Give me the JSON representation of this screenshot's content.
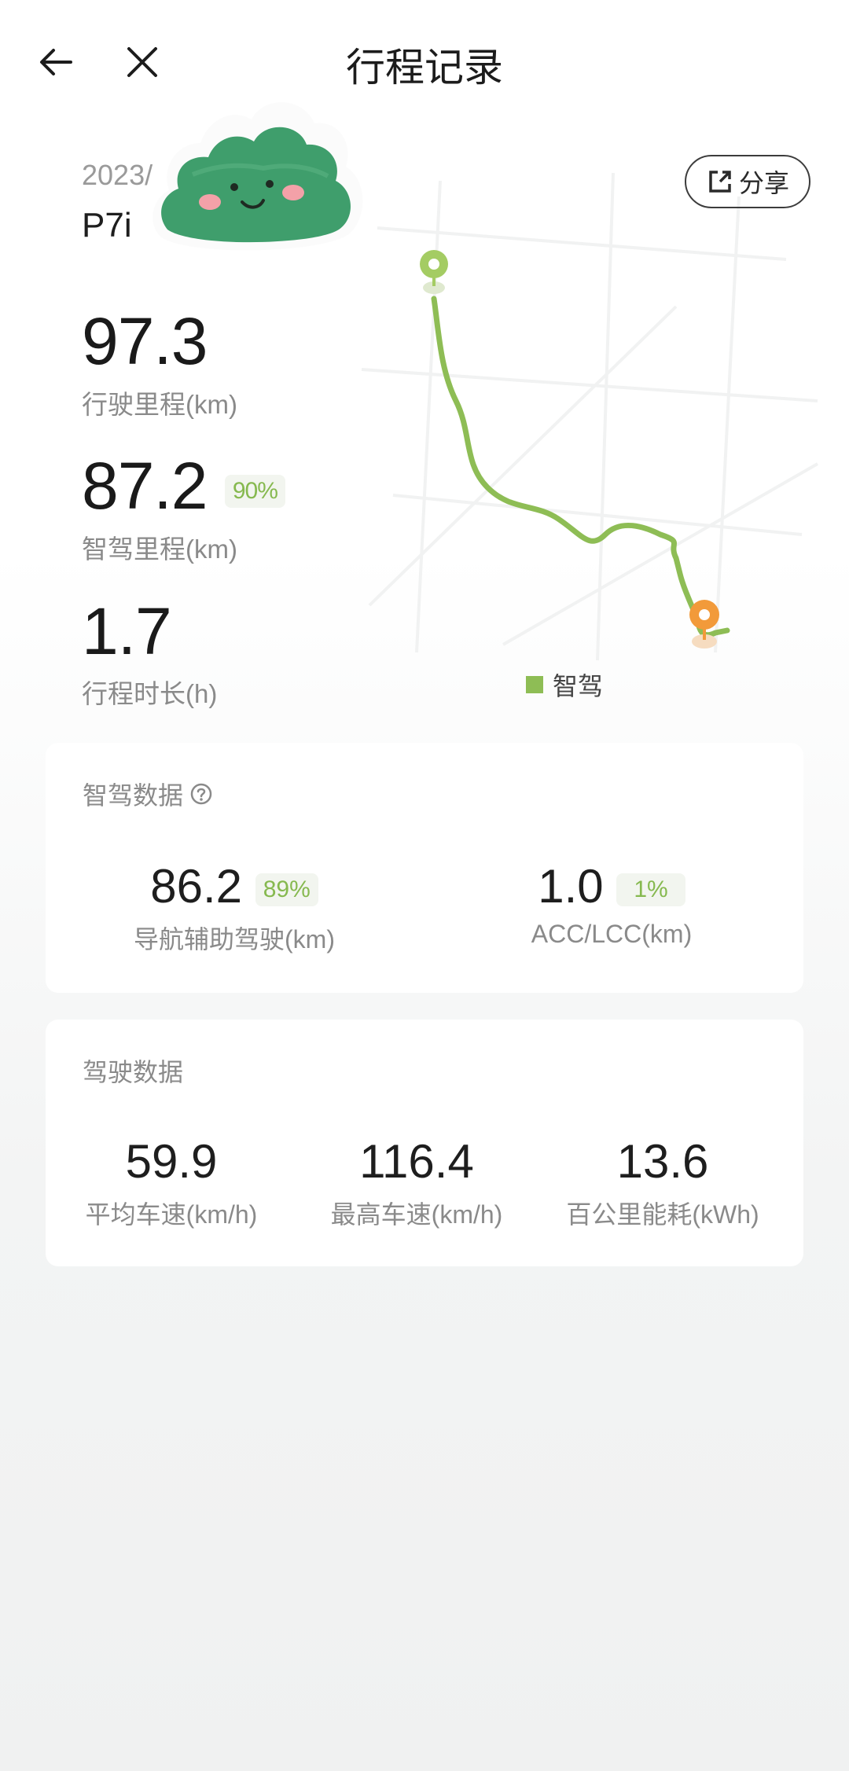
{
  "header": {
    "title": "行程记录",
    "back_icon": "arrow-left-icon",
    "close_icon": "close-icon"
  },
  "trip": {
    "date": "2023/",
    "model": "P7i",
    "share_label": "分享",
    "distance": {
      "value": "97.3",
      "label": "行驶里程(km)"
    },
    "smart_distance": {
      "value": "87.2",
      "percent": "90%",
      "label": "智驾里程(km)"
    },
    "duration": {
      "value": "1.7",
      "label": "行程时长(h)"
    }
  },
  "map": {
    "legend": "智驾",
    "route_color": "#8ebd55",
    "start_color": "#a4cc63",
    "end_color": "#f29a3a"
  },
  "smart_driving": {
    "title": "智驾数据",
    "items": [
      {
        "value": "86.2",
        "percent": "89%",
        "label": "导航辅助驾驶(km)"
      },
      {
        "value": "1.0",
        "percent": "1%",
        "label": "ACC/LCC(km)"
      }
    ]
  },
  "driving": {
    "title": "驾驶数据",
    "items": [
      {
        "value": "59.9",
        "label": "平均车速(km/h)"
      },
      {
        "value": "116.4",
        "label": "最高车速(km/h)"
      },
      {
        "value": "13.6",
        "label": "百公里能耗(kWh)"
      }
    ]
  }
}
